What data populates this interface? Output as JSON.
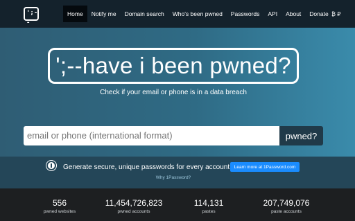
{
  "nav": {
    "logo": "';--",
    "items": [
      {
        "label": "Home",
        "active": true
      },
      {
        "label": "Notify me"
      },
      {
        "label": "Domain search"
      },
      {
        "label": "Who's been pwned"
      },
      {
        "label": "Passwords"
      },
      {
        "label": "API"
      },
      {
        "label": "About"
      },
      {
        "label": "Donate"
      }
    ],
    "donate_icons": "₿ ₽"
  },
  "hero": {
    "title": "';--have i been pwned?",
    "tagline": "Check if your email or phone is in a data breach"
  },
  "search": {
    "placeholder": "email or phone (international format)",
    "button_label": "pwned?"
  },
  "promo": {
    "text": "Generate secure, unique passwords for every account",
    "cta_label": "Learn more at 1Password.com",
    "why_link": "Why 1Password?",
    "cta_color": "#1a8cff"
  },
  "stats": [
    {
      "value": "556",
      "label": "pwned websites"
    },
    {
      "value": "11,454,726,823",
      "label": "pwned accounts"
    },
    {
      "value": "114,131",
      "label": "pastes"
    },
    {
      "value": "207,749,076",
      "label": "paste accounts"
    }
  ],
  "colors": {
    "navbar": "#14222c",
    "hero": "#2f6b85",
    "band": "#244658",
    "stats": "#1d1f21"
  }
}
